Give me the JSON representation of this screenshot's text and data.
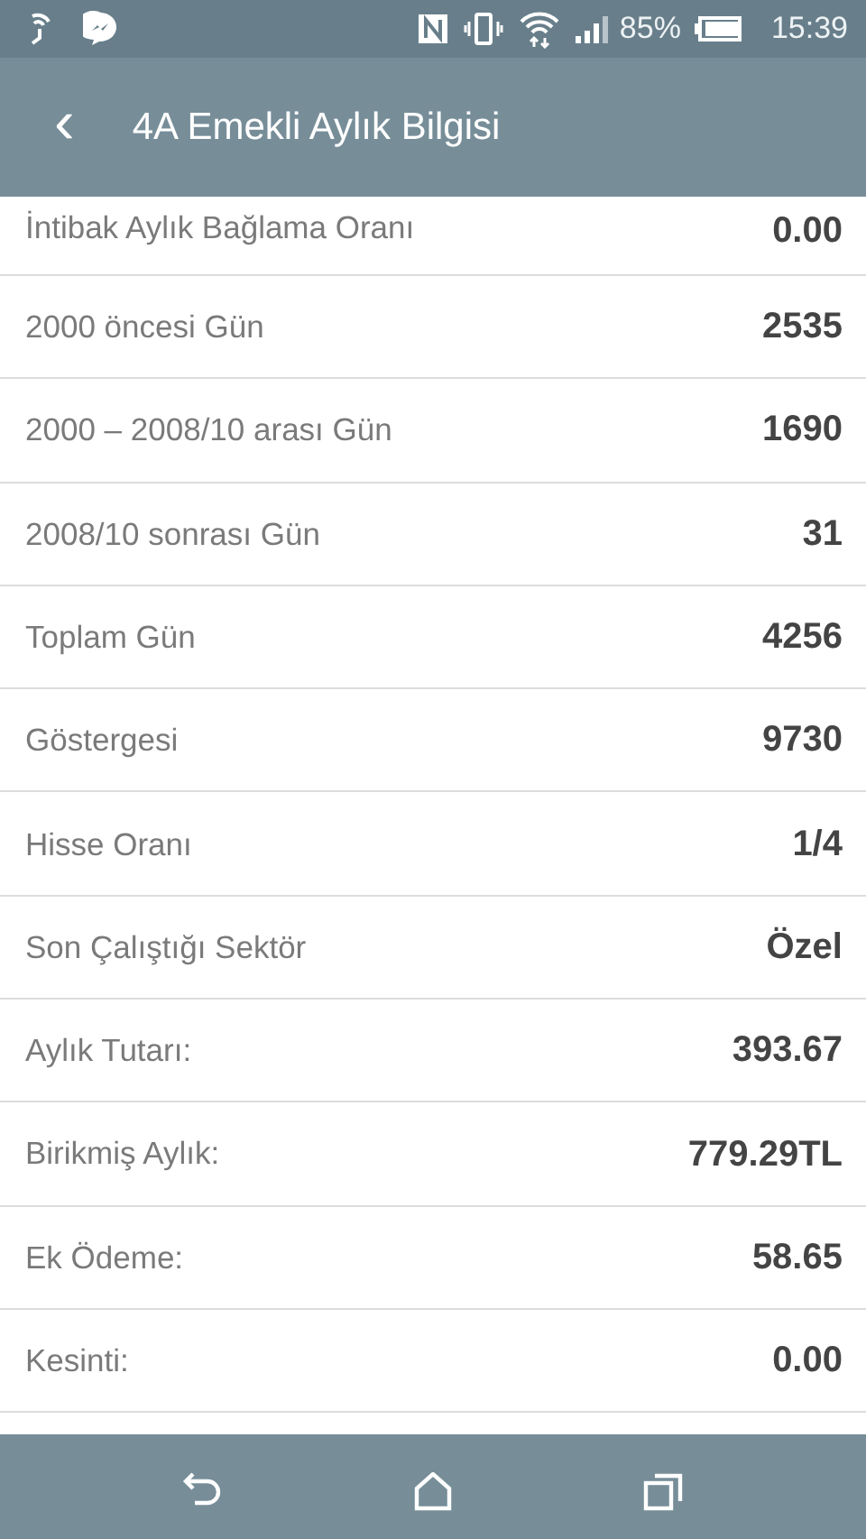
{
  "status_bar": {
    "battery": "85%",
    "time": "15:39"
  },
  "app_bar": {
    "back": "‹",
    "title": "4A Emekli Aylık Bilgisi"
  },
  "rows": [
    {
      "label": "İntibak Aylık Bağlama Oranı",
      "value": "0.00"
    },
    {
      "label": "2000 öncesi Gün",
      "value": "2535"
    },
    {
      "label": "2000 – 2008/10 arası Gün",
      "value": "1690"
    },
    {
      "label": "2008/10 sonrası Gün",
      "value": "31"
    },
    {
      "label": "Toplam Gün",
      "value": "4256"
    },
    {
      "label": "Göstergesi",
      "value": "9730"
    },
    {
      "label": "Hisse Oranı",
      "value": "1/4"
    },
    {
      "label": "Son Çalıştığı Sektör",
      "value": "Özel"
    },
    {
      "label": "Aylık Tutarı:",
      "value": "393.67"
    },
    {
      "label": "Birikmiş Aylık:",
      "value": "779.29TL"
    },
    {
      "label": "Ek Ödeme:",
      "value": "58.65"
    },
    {
      "label": "Kesinti:",
      "value": "0.00"
    }
  ]
}
